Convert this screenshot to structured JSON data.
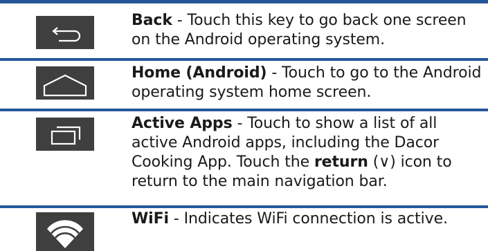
{
  "rows": [
    {
      "icon": "back-arrow-icon",
      "title": "Back",
      "text": " - Touch this key to go back one screen on the Android operating system."
    },
    {
      "icon": "home-icon",
      "title": "Home (Android)",
      "text": " - Touch to go to the Android operating system home screen."
    },
    {
      "icon": "recent-apps-icon",
      "title": "Active Apps",
      "text": " - Touch to show a list of all active Android apps, including the Dacor Cooking App. Touch the ",
      "emphasis": "return",
      "text_after": " (∨) icon to return to the main navigation bar."
    },
    {
      "icon": "wifi-icon",
      "title": "WiFi",
      "text": " - Indicates WiFi connection is active."
    }
  ],
  "colors": {
    "rule": "#24579a",
    "button_bg": "#3f3f3f",
    "icon_stroke": "#ffffff",
    "text": "#1a1a1a"
  }
}
